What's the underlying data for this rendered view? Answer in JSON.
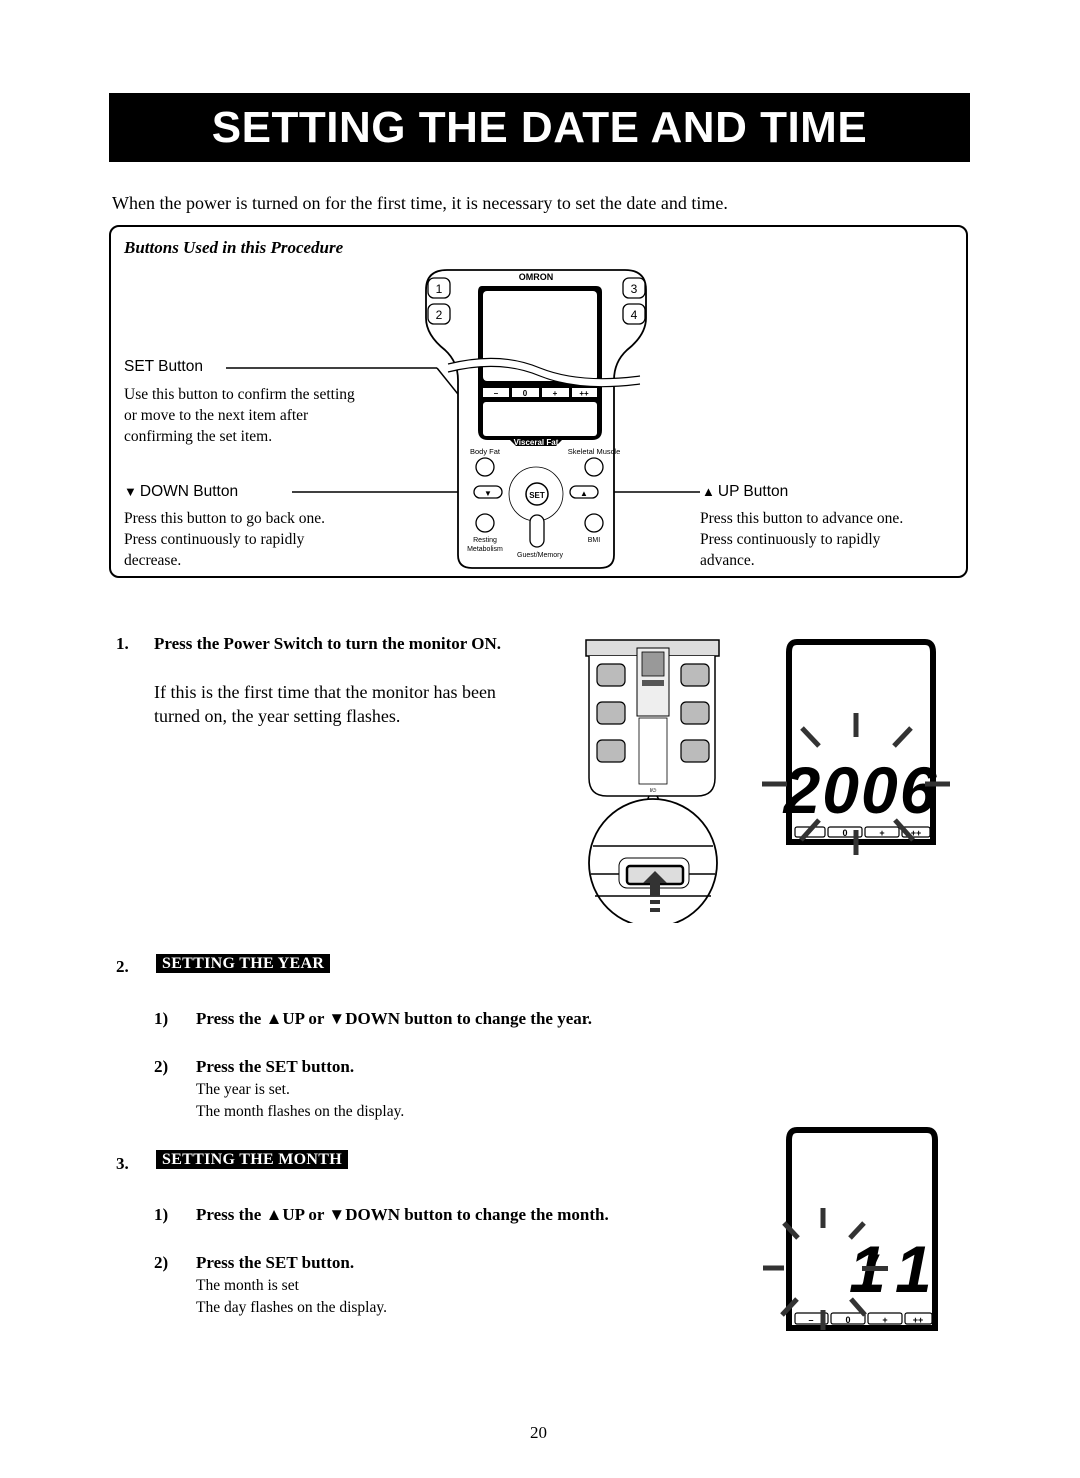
{
  "page": {
    "title": "SETTING THE DATE AND TIME",
    "intro": "When the power is turned on for the first time, it is necessary to set the date and time.",
    "page_number": "20"
  },
  "buttons_panel": {
    "title": "Buttons Used in this Procedure",
    "set_button": {
      "label": "SET Button",
      "desc": [
        "Use this button to confirm the setting",
        "or move to the next item after",
        "confirming the set item."
      ]
    },
    "down_button": {
      "icon": "triangle-down-icon",
      "glyph": "▼",
      "label": "DOWN Button",
      "desc": [
        "Press this button to go back one.",
        "Press continuously to rapidly",
        "decrease."
      ]
    },
    "up_button": {
      "icon": "triangle-up-icon",
      "glyph": "▲",
      "label": "UP Button",
      "desc": [
        "Press this button to advance one.",
        "Press continuously to rapidly",
        "advance."
      ]
    },
    "device": {
      "brand": "OMRON",
      "user_keys": [
        "1",
        "2",
        "3",
        "4"
      ],
      "level_keys": [
        "–",
        "0",
        "+",
        "++"
      ],
      "set_key": "SET",
      "labels": {
        "body_fat": "Body Fat",
        "visceral_fat": "Visceral Fat",
        "skeletal_muscle": "Skeletal Muscle",
        "resting_metabolism_1": "Resting",
        "resting_metabolism_2": "Metabolism",
        "bmi": "BMI",
        "guest_memory": "Guest/Memory"
      }
    }
  },
  "steps": [
    {
      "num": "1.",
      "heading": "Press the Power Switch to turn the monitor ON.",
      "body": [
        "If this is the first time that the monitor has been",
        "turned on, the year setting flashes."
      ]
    },
    {
      "num": "2.",
      "section": "SETTING THE YEAR",
      "substeps": [
        {
          "num": "1)",
          "pre": "Press the ",
          "up": "▲",
          "mid1": "UP or ",
          "down": "▼",
          "post": "DOWN button to change the year."
        },
        {
          "num": "2)",
          "text": "Press the SET button.",
          "notes": [
            "The year is set.",
            "The month flashes on the display."
          ]
        }
      ]
    },
    {
      "num": "3.",
      "section": "SETTING THE MONTH",
      "substeps": [
        {
          "num": "1)",
          "pre": "Press the ",
          "up": "▲",
          "mid1": "UP or ",
          "down": "▼",
          "post": "DOWN button to change the month."
        },
        {
          "num": "2)",
          "text": "Press the SET button.",
          "notes": [
            "The month is set",
            "The day flashes on the display."
          ]
        }
      ]
    }
  ],
  "displays": {
    "year": {
      "value": "2006",
      "flashing": true,
      "level_keys": [
        "–",
        "0",
        "+",
        "++"
      ]
    },
    "month": {
      "value": "1/-1",
      "month_digit": "1",
      "separator": "/",
      "dash": "-",
      "day_digit": "1",
      "flashing": true,
      "level_keys": [
        "–",
        "0",
        "+",
        "++"
      ]
    }
  },
  "scale_illustration": {
    "power_label": "I/⏻"
  }
}
